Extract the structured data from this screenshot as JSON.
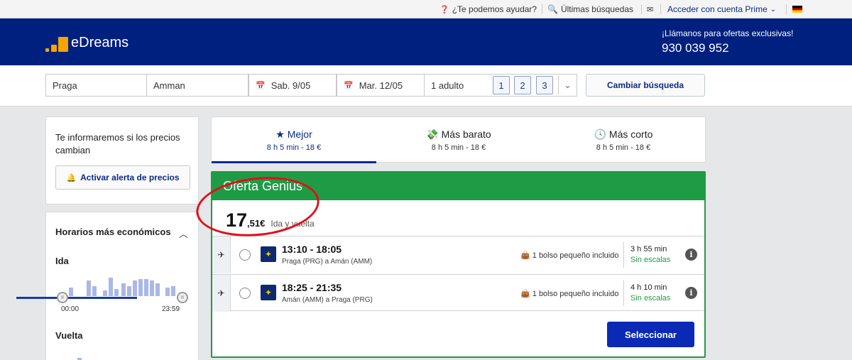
{
  "topbar": {
    "help": "¿Te podemos ayudar?",
    "recent": "Últimas búsquedas",
    "login": "Acceder con cuenta Prime"
  },
  "header": {
    "logo": "eDreams",
    "call_text": "¡Llámanos para ofertas exclusivas!",
    "phone": "930 039 952"
  },
  "search": {
    "origin": "Praga",
    "destination": "Amman",
    "depart": "Sab. 9/05",
    "return": "Mar. 12/05",
    "passengers": "1 adulto",
    "pax_options": [
      "1",
      "2",
      "3"
    ],
    "change_label": "Cambiar búsqueda"
  },
  "sidebar": {
    "alert_text": "Te informaremos si los precios cambian",
    "alert_button": "Activar alerta de precios",
    "times_title": "Horarios más económicos",
    "ida": "Ida",
    "vuelta": "Vuelta",
    "slider_min": "00:00",
    "slider_max": "23:59"
  },
  "tabs": [
    {
      "label": "Mejor",
      "sub": "8 h 5 min - 18 €"
    },
    {
      "label": "Más barato",
      "sub": "8 h 5 min - 18 €"
    },
    {
      "label": "Más corto",
      "sub": "8 h 5 min - 18 €"
    }
  ],
  "result": {
    "banner": "Oferta Genius",
    "price_int": "17",
    "price_dec": ",51€",
    "trip_type": "Ida y vuelta",
    "legs": [
      {
        "time": "13:10 - 18:05",
        "route": "Praga (PRG) a Amán (AMM)",
        "bag": "1 bolso pequeño incluido",
        "duration": "3 h 55 min",
        "stops": "Sin escalas"
      },
      {
        "time": "18:25 - 21:35",
        "route": "Amán (AMM) a Praga (PRG)",
        "bag": "1 bolso pequeño incluido",
        "duration": "4 h 10 min",
        "stops": "Sin escalas"
      }
    ],
    "select_label": "Seleccionar"
  },
  "colors": {
    "brand_navy": "#002080",
    "genius_green": "#1f9b45",
    "accent_orange": "#f5a400",
    "select_blue": "#0a2ab5",
    "annotation_red": "#e0101a"
  }
}
